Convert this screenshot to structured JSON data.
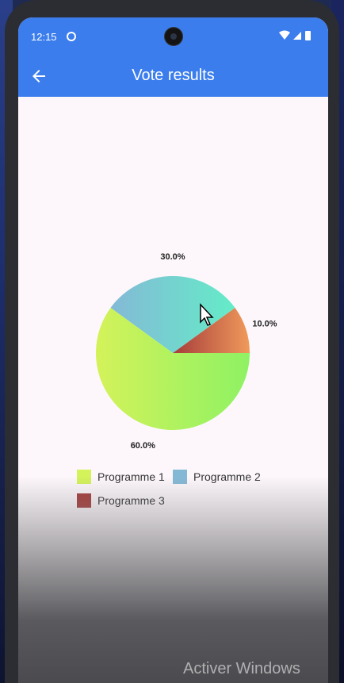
{
  "status_bar": {
    "time": "12:15"
  },
  "app_bar": {
    "title": "Vote results"
  },
  "chart_data": {
    "type": "pie",
    "slices": [
      {
        "label": "Programme 1",
        "value": 60.0,
        "display": "60.0%",
        "color": "#d4f25a",
        "color2": "#8ef263"
      },
      {
        "label": "Programme 2",
        "value": 30.0,
        "display": "30.0%",
        "color": "#84b9d6",
        "color2": "#64ecc8"
      },
      {
        "label": "Programme 3",
        "value": 10.0,
        "display": "10.0%",
        "color": "#a63c3c",
        "color2": "#f09a5a"
      }
    ],
    "legend": [
      "Programme 1",
      "Programme 2",
      "Programme 3"
    ],
    "legend_position": "bottom"
  },
  "watermark": "Activer Windows"
}
